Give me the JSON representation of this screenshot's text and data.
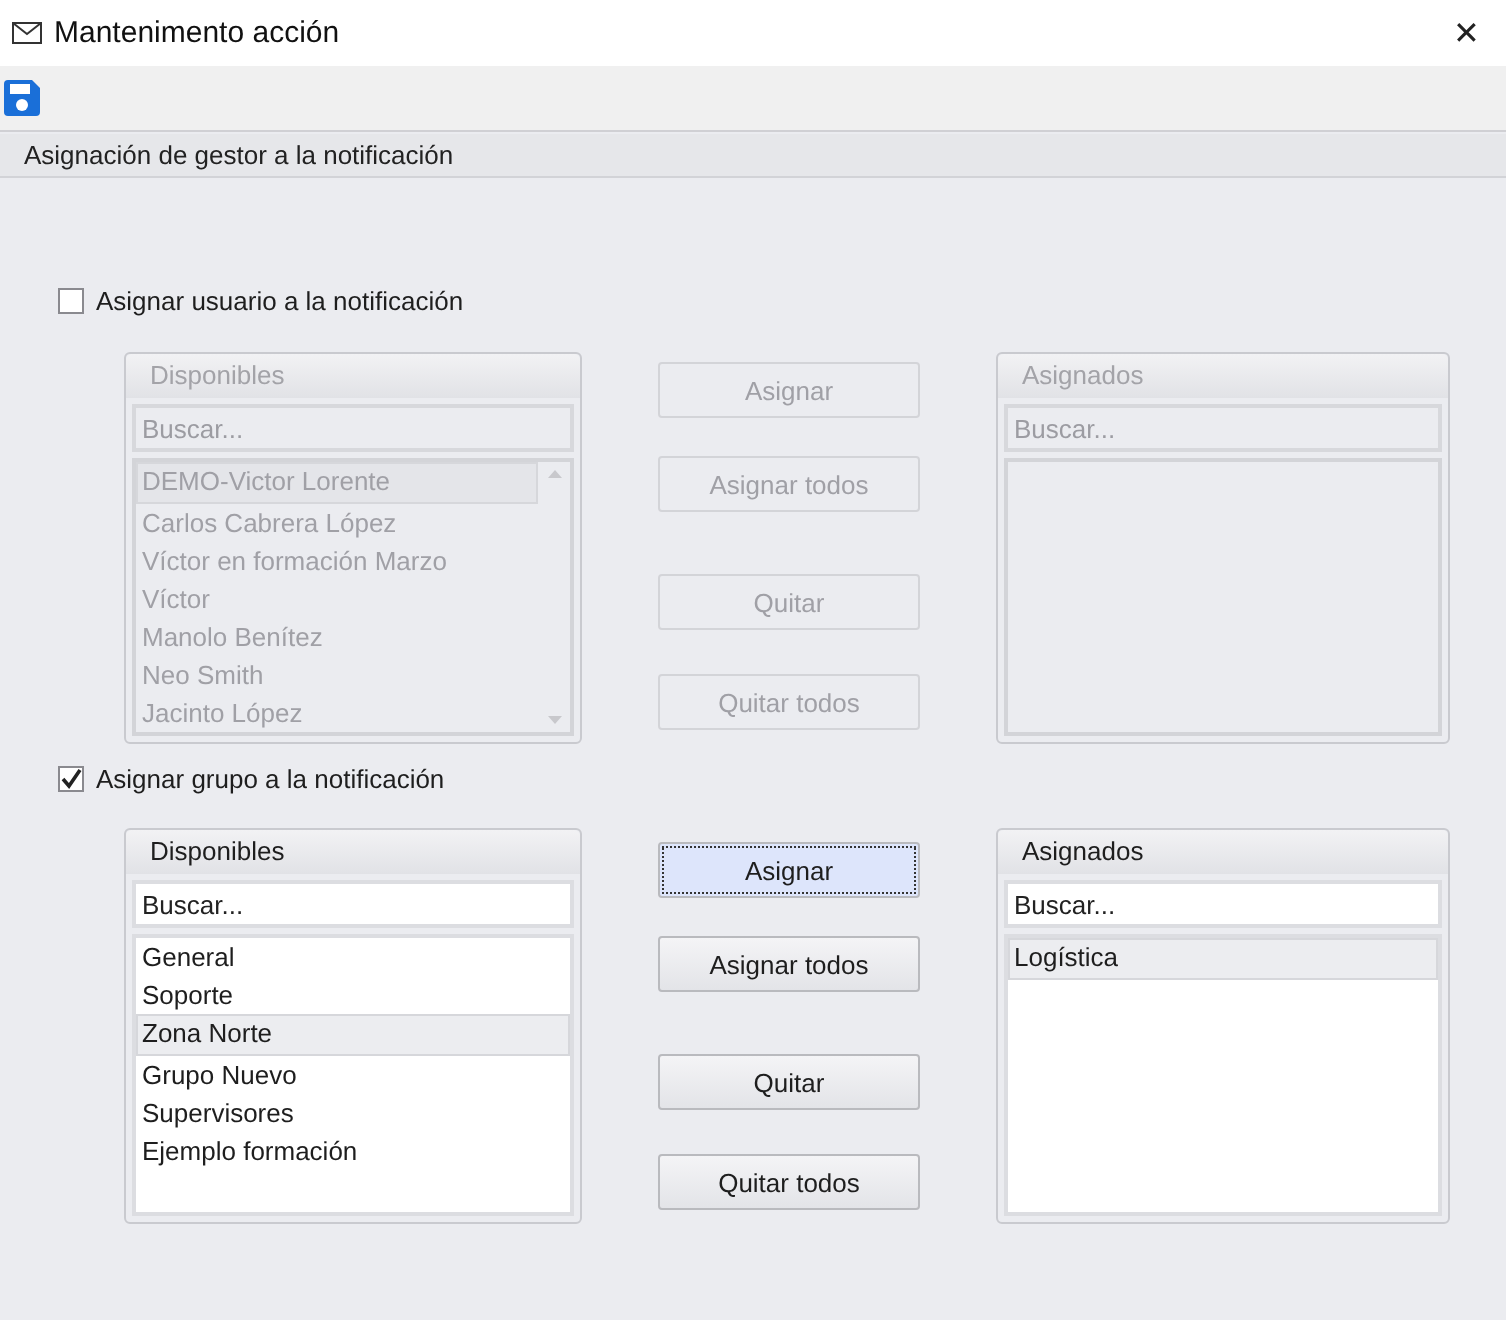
{
  "window": {
    "title": "Mantenimento acción",
    "close": "✕"
  },
  "section_header": "Asignación de gestor a la notificación",
  "groups": [
    {
      "label": "Asignar usuario a la notificación",
      "checked": false,
      "available": {
        "title": "Disponibles",
        "placeholder": "Buscar...",
        "items": [
          {
            "text": "DEMO-Victor Lorente",
            "selected": true
          },
          {
            "text": "Carlos Cabrera López",
            "selected": false
          },
          {
            "text": "Víctor en formación Marzo",
            "selected": false
          },
          {
            "text": "Víctor",
            "selected": false
          },
          {
            "text": "Manolo Benítez",
            "selected": false
          },
          {
            "text": "Neo Smith",
            "selected": false
          },
          {
            "text": "Jacinto López",
            "selected": false
          }
        ]
      },
      "buttons": [
        {
          "label": "Asignar",
          "focused": false
        },
        {
          "label": "Asignar todos",
          "focused": false
        },
        {
          "label": "Quitar",
          "focused": false
        },
        {
          "label": "Quitar todos",
          "focused": false
        }
      ],
      "assigned": {
        "title": "Asignados",
        "placeholder": "Buscar..."
      }
    },
    {
      "label": "Asignar grupo a la notificación",
      "checked": true,
      "available": {
        "title": "Disponibles",
        "placeholder": "Buscar...",
        "items": [
          {
            "text": "General",
            "selected": false
          },
          {
            "text": "Soporte",
            "selected": false
          },
          {
            "text": "Zona Norte",
            "selected": true
          },
          {
            "text": "Grupo Nuevo",
            "selected": false
          },
          {
            "text": "Supervisores",
            "selected": false
          },
          {
            "text": "Ejemplo formación",
            "selected": false
          }
        ]
      },
      "buttons": [
        {
          "label": "Asignar",
          "focused": true
        },
        {
          "label": "Asignar todos",
          "focused": false
        },
        {
          "label": "Quitar",
          "focused": false
        },
        {
          "label": "Quitar todos",
          "focused": false
        }
      ],
      "assigned": {
        "title": "Asignados",
        "placeholder": "Buscar...",
        "items": [
          {
            "text": "Logística",
            "selected": true
          }
        ]
      }
    }
  ]
}
